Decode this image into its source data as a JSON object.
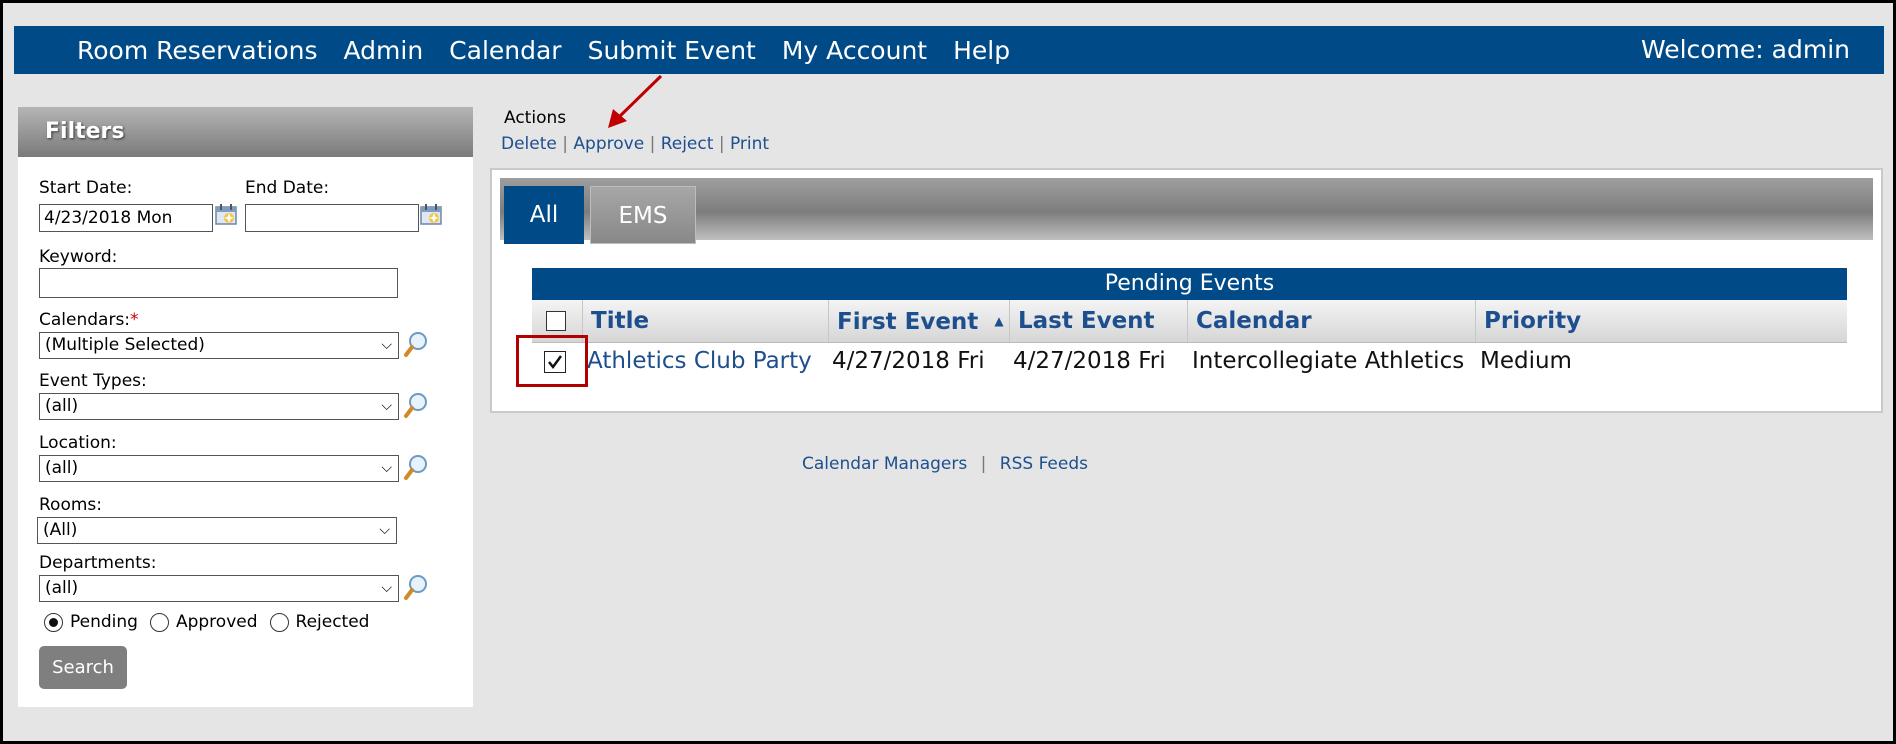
{
  "nav": {
    "items": [
      "Room Reservations",
      "Admin",
      "Calendar",
      "Submit Event",
      "My Account",
      "Help"
    ],
    "welcome": "Welcome: admin"
  },
  "filters": {
    "title": "Filters",
    "start_date_label": "Start Date:",
    "start_date_value": "4/23/2018 Mon",
    "end_date_label": "End Date:",
    "end_date_value": "",
    "keyword_label": "Keyword:",
    "keyword_value": "",
    "calendars_label": "Calendars:",
    "calendars_required": "*",
    "calendars_value": "(Multiple Selected)",
    "event_types_label": "Event Types:",
    "event_types_value": "(all)",
    "location_label": "Location:",
    "location_value": "(all)",
    "rooms_label": "Rooms:",
    "rooms_value": "(All)",
    "departments_label": "Departments:",
    "departments_value": "(all)",
    "status_options": [
      "Pending",
      "Approved",
      "Rejected"
    ],
    "status_selected": "Pending",
    "search_label": "Search"
  },
  "actions": {
    "title": "Actions",
    "links": [
      "Delete",
      "Approve",
      "Reject",
      "Print"
    ],
    "separator": "|"
  },
  "tabs": [
    "All",
    "EMS"
  ],
  "table": {
    "title": "Pending Events",
    "columns": [
      "Title",
      "First Event",
      "Last Event",
      "Calendar",
      "Priority"
    ],
    "sort_indicator": "▲",
    "rows": [
      {
        "checked": true,
        "title": "Athletics Club Party",
        "first_event": "4/27/2018 Fri",
        "last_event": "4/27/2018 Fri",
        "calendar": "Intercollegiate Athletics",
        "priority": "Medium"
      }
    ]
  },
  "footer": {
    "links": [
      "Calendar Managers",
      "RSS Feeds"
    ],
    "separator": "|"
  },
  "colors": {
    "brand": "#004a87",
    "link": "#1d4f8f",
    "highlight": "#b00000"
  }
}
